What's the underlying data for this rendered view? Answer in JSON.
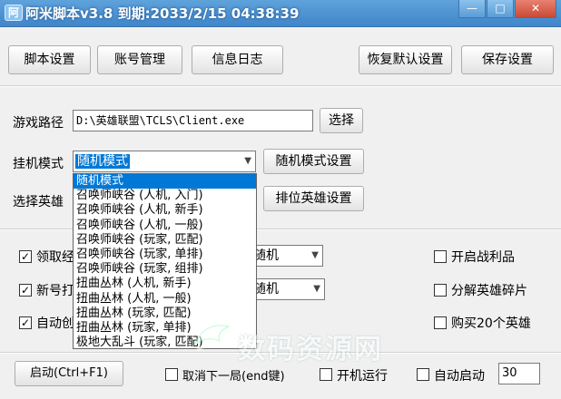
{
  "window": {
    "icon_glyph": "阿",
    "title": "阿米脚本v3.8 到期:2033/2/15 04:38:39",
    "controls": [
      "—",
      "□",
      "✕"
    ]
  },
  "toolbar": {
    "script_settings": "脚本设置",
    "account_mgmt": "账号管理",
    "info_log": "信息日志",
    "restore_defaults": "恢复默认设置",
    "save_settings": "保存设置"
  },
  "game_path": {
    "label": "游戏路径",
    "value": "D:\\英雄联盟\\TCLS\\Client.exe",
    "browse_button": "选择"
  },
  "hang_mode": {
    "label": "挂机模式",
    "selected": "随机模式",
    "settings_button": "随机模式设置",
    "options": [
      "随机模式",
      "召唤师峡谷 (人机, 入门)",
      "召唤师峡谷 (人机, 新手)",
      "召唤师峡谷 (人机, 一般)",
      "召唤师峡谷 (玩家, 匹配)",
      "召唤师峡谷 (玩家, 单排)",
      "召唤师峡谷 (玩家, 组排)",
      "扭曲丛林 (人机, 新手)",
      "扭曲丛林 (人机, 一般)",
      "扭曲丛林 (玩家, 匹配)",
      "扭曲丛林 (玩家, 单排)",
      "极地大乱斗 (玩家, 匹配)"
    ]
  },
  "hero_select": {
    "label": "选择英雄",
    "sort_button": "排位英雄设置"
  },
  "options": {
    "receive_label": "领取经",
    "newbie_label": "新号打",
    "auto_label": "自动创",
    "combo1_value": "随机",
    "combo2_value": "随机",
    "open_loot": "开启战利品",
    "decompose_shards": "分解英雄碎片",
    "buy_heroes": "购买20个英雄"
  },
  "footer": {
    "start_button": "启动(Ctrl+F1)",
    "cancel_next": "取消下一局(end键)",
    "startup_run": "开机运行",
    "auto_start": "自动启动",
    "auto_start_seconds": "30"
  },
  "watermark": "数码资源网"
}
